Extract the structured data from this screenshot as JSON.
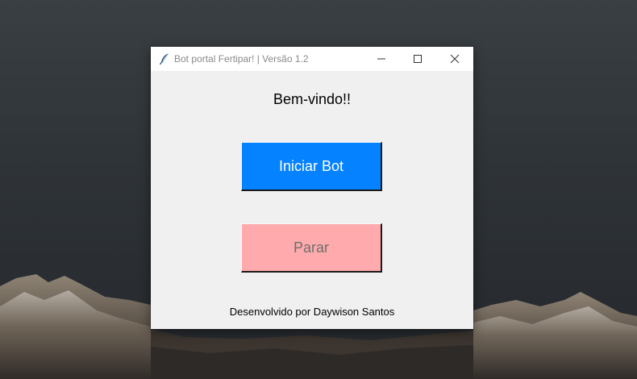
{
  "window": {
    "title": "Bot portal Fertipar! | Versão 1.2"
  },
  "main": {
    "welcome": "Bem-vindo!!",
    "start_button": "Iniciar Bot",
    "stop_button": "Parar",
    "footer": "Desenvolvido por Daywison Santos"
  },
  "colors": {
    "start_button_bg": "#0582ff",
    "stop_button_bg": "#ffabad",
    "window_bg": "#f0f0f0"
  },
  "icons": {
    "app": "feather-icon",
    "minimize": "minimize-icon",
    "maximize": "maximize-icon",
    "close": "close-icon"
  }
}
